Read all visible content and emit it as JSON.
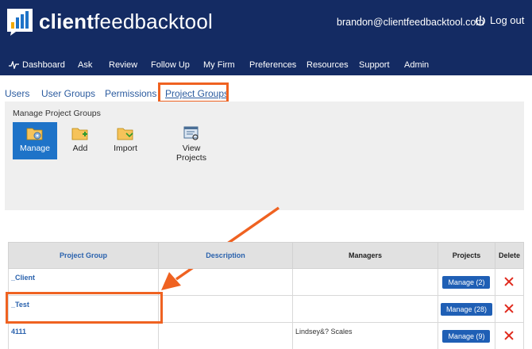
{
  "header": {
    "brand_bold": "client",
    "brand_light": "feedbacktool",
    "user_email": "brandon@clientfeedbacktool.com",
    "logout_label": "Log out"
  },
  "nav": {
    "items": [
      "Dashboard",
      "Ask",
      "Review",
      "Follow Up",
      "My Firm",
      "Preferences",
      "Resources",
      "Support",
      "Admin"
    ]
  },
  "subtabs": {
    "items": [
      "Users",
      "User Groups",
      "Permissions",
      "Project Groups"
    ],
    "active": "Project Groups"
  },
  "panel": {
    "title": "Manage Project Groups",
    "tools": {
      "manage": "Manage",
      "add": "Add",
      "import": "Import",
      "view_line1": "View",
      "view_line2": "Projects"
    }
  },
  "table": {
    "headers": {
      "group": "Project Group",
      "description": "Description",
      "managers": "Managers",
      "projects": "Projects",
      "delete": "Delete"
    },
    "rows": [
      {
        "name": "_Client",
        "description": "",
        "managers": "",
        "projects": "Manage (2)"
      },
      {
        "name": "_Test",
        "description": "",
        "managers": "",
        "projects": "Manage (28)"
      },
      {
        "name": "4111",
        "description": "",
        "managers": "Lindsey&? Scales",
        "projects": "Manage (9)"
      }
    ]
  },
  "colors": {
    "header_bg": "#142b63",
    "accent_orange": "#ef6221",
    "button_blue": "#1f5fb5",
    "delete_red": "#e0291c"
  }
}
